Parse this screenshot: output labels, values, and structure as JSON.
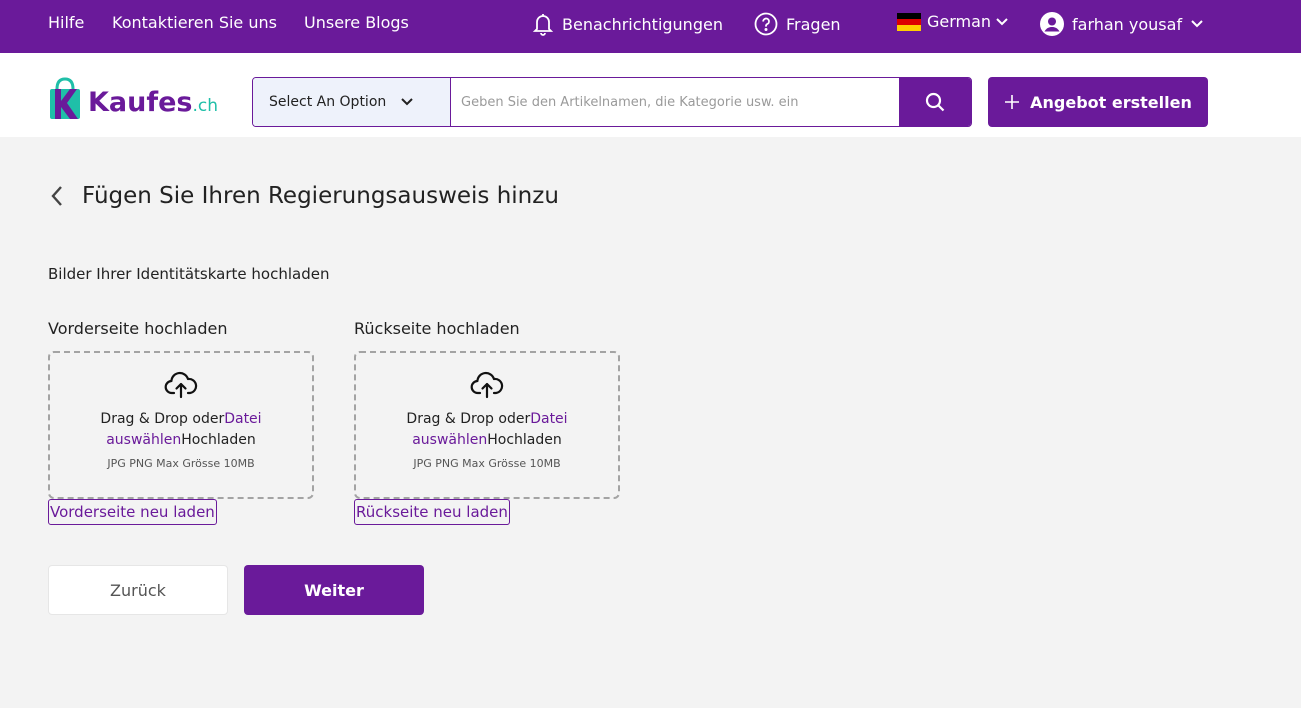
{
  "topbar": {
    "help": "Hilfe",
    "contact": "Kontaktieren Sie uns",
    "blogs": "Unsere Blogs",
    "notifications": "Benachrichtigungen",
    "questions": "Fragen",
    "language": "German",
    "user_name": "farhan yousaf"
  },
  "header": {
    "logo_main": "Kaufes",
    "logo_tld": ".ch",
    "category_select": "Select An Option",
    "search_placeholder": "Geben Sie den Artikelnamen, die Kategorie usw. ein",
    "create_listing": "Angebot erstellen"
  },
  "page": {
    "title": "Fügen Sie Ihren Regierungsausweis hinzu",
    "section_label": "Bilder Ihrer Identitätskarte hochladen",
    "front": {
      "label": "Vorderseite hochladen",
      "dz_prefix": "Drag & Drop oder",
      "dz_link": "Datei auswählen",
      "dz_suffix": "Hochladen",
      "dz_hint": "JPG PNG Max Grösse 10MB",
      "reload": "Vorderseite neu laden"
    },
    "back": {
      "label": "Rückseite hochladen",
      "dz_prefix": "Drag & Drop oder",
      "dz_link": "Datei auswählen",
      "dz_suffix": "Hochladen",
      "dz_hint": "JPG PNG Max Grösse 10MB",
      "reload": "Rückseite neu laden"
    },
    "btn_back": "Zurück",
    "btn_next": "Weiter"
  },
  "colors": {
    "brand": "#6a1a9a",
    "accent": "#1fbfa8",
    "background": "#f3f3f3"
  }
}
